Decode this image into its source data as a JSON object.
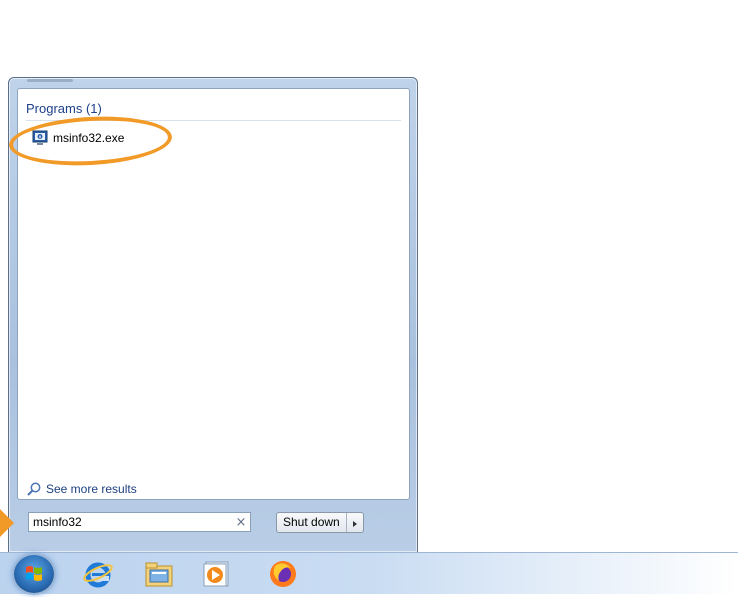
{
  "start_menu": {
    "section_header": "Programs (1)",
    "results": [
      {
        "label": "msinfo32.exe",
        "icon": "system-info-icon"
      }
    ],
    "see_more": "See more results"
  },
  "search": {
    "value": "msinfo32",
    "clear_glyph": "×"
  },
  "power": {
    "shutdown_label": "Shut down"
  },
  "taskbar": {
    "pinned": [
      "start-orb",
      "internet-explorer-icon",
      "file-explorer-icon",
      "media-player-icon",
      "firefox-icon"
    ]
  },
  "colors": {
    "highlight": "#f29a28",
    "header_text": "#1e3f8a",
    "link_text": "#1d3f7f"
  }
}
